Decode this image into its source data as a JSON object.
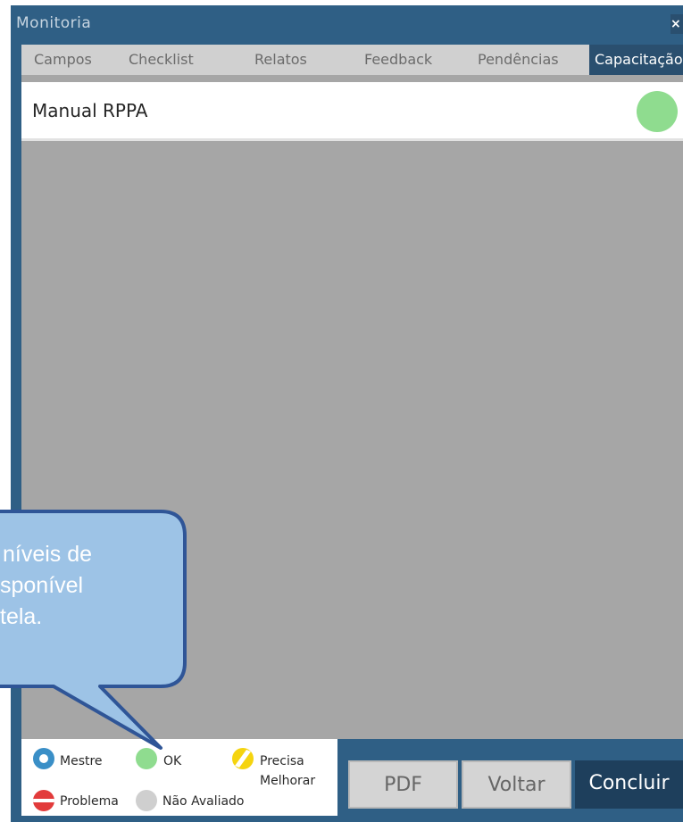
{
  "window": {
    "title": "Monitoria",
    "close_label": "×"
  },
  "tabs": [
    {
      "label": "Campos"
    },
    {
      "label": "Checklist"
    },
    {
      "label": "Relatos"
    },
    {
      "label": "Feedback"
    },
    {
      "label": "Pendências"
    },
    {
      "label": "Capacitação"
    }
  ],
  "active_tab": "Capacitação",
  "items": [
    {
      "label": "Manual RPPA",
      "status": "OK",
      "status_color": "#8fdc8f"
    }
  ],
  "legend": {
    "mestre": "Mestre",
    "ok": "OK",
    "precisa_1": "Precisa",
    "precisa_2": "Melhorar",
    "problema": "Problema",
    "nao_avaliado": "Não Avaliado"
  },
  "buttons": {
    "pdf": "PDF",
    "voltar": "Voltar",
    "concluir": "Concluir"
  },
  "callout": {
    "line1": "níveis de",
    "line2": "sponível",
    "line3": "tela."
  },
  "colors": {
    "window": "#2f5f85",
    "tab_active": "#2a4f6f",
    "content_bg": "#a6a6a6",
    "ok": "#8fdc8f",
    "mestre": "#3a8fc7",
    "precisa": "#f5d40f",
    "problema": "#e23b3b",
    "nao_avaliado": "#cfcfcf",
    "callout_fill": "#9dc3e6",
    "callout_border": "#2f5597"
  }
}
